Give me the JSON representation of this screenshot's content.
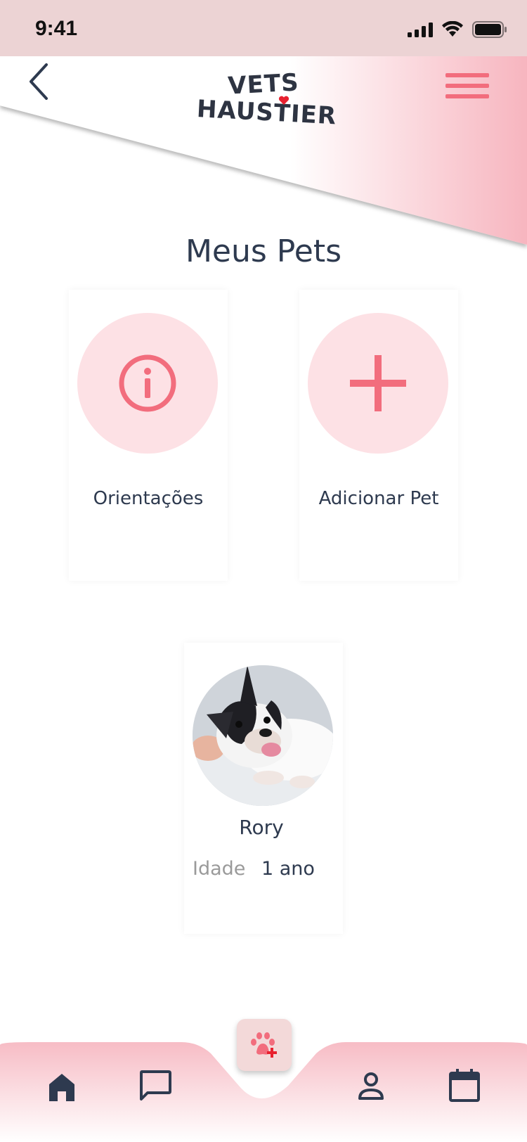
{
  "status_bar": {
    "time": "9:41"
  },
  "header": {
    "logo_line1": "VETS",
    "logo_line2": "HAUSTIER"
  },
  "page_title": "Meus Pets",
  "cards": {
    "guidance_label": "Orientações",
    "add_pet_label": "Adicionar Pet"
  },
  "pet": {
    "name": "Rory",
    "age_label": "Idade",
    "age_value": "1 ano"
  },
  "colors": {
    "accent": "#f26d7d",
    "circle_bg": "#fde1e5",
    "status_bar_bg": "#ecd3d4",
    "text": "#2e3a4f"
  },
  "icons": {
    "back": "chevron-left-icon",
    "menu": "hamburger-menu-icon",
    "info": "info-icon",
    "add": "plus-icon",
    "home": "home-icon",
    "chat": "chat-icon",
    "pet_add": "paw-plus-icon",
    "profile": "user-icon",
    "calendar": "calendar-icon"
  }
}
